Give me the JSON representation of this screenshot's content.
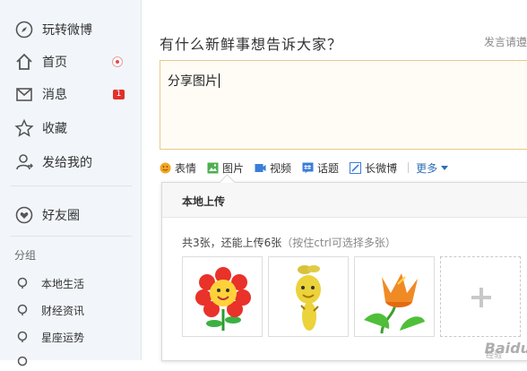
{
  "sidebar": {
    "items": [
      {
        "label": "玩转微博",
        "icon": "compass-icon"
      },
      {
        "label": "首页",
        "icon": "home-icon"
      },
      {
        "label": "消息",
        "icon": "message-icon",
        "badge": "1"
      },
      {
        "label": "收藏",
        "icon": "star-icon"
      },
      {
        "label": "发给我的",
        "icon": "person-share-icon"
      },
      {
        "label": "好友圈",
        "icon": "heart-circle-icon"
      }
    ],
    "group_title": "分组",
    "groups": [
      {
        "label": "本地生活"
      },
      {
        "label": "财经资讯"
      },
      {
        "label": "星座运势"
      }
    ]
  },
  "composer": {
    "prompt": "有什么新鲜事想告诉大家？",
    "notice": "发言请遵",
    "text_value": "分享图片",
    "toolbar": [
      {
        "label": "表情",
        "icon": "smiley-icon",
        "color": "#f4a623"
      },
      {
        "label": "图片",
        "icon": "image-icon",
        "color": "#4caf50"
      },
      {
        "label": "视频",
        "icon": "video-icon",
        "color": "#3b7dd8"
      },
      {
        "label": "话题",
        "icon": "topic-icon",
        "color": "#3b7dd8"
      },
      {
        "label": "长微博",
        "icon": "long-post-icon",
        "color": "#3b7dd8"
      }
    ],
    "more_label": "更多"
  },
  "upload_panel": {
    "title": "本地上传",
    "count_text": "共3张，还能上传6张",
    "hint_text": "（按住ctrl可选择多张）",
    "thumbnails": [
      {
        "icon": "red-flower-icon"
      },
      {
        "icon": "yellow-sprout-icon"
      },
      {
        "icon": "orange-tulip-icon"
      }
    ]
  },
  "watermark": {
    "text": "Baidu",
    "sub": "经验"
  },
  "colors": {
    "accent": "#e24a4a",
    "link": "#2c6eb5",
    "textbox_border": "#e9c98c"
  }
}
